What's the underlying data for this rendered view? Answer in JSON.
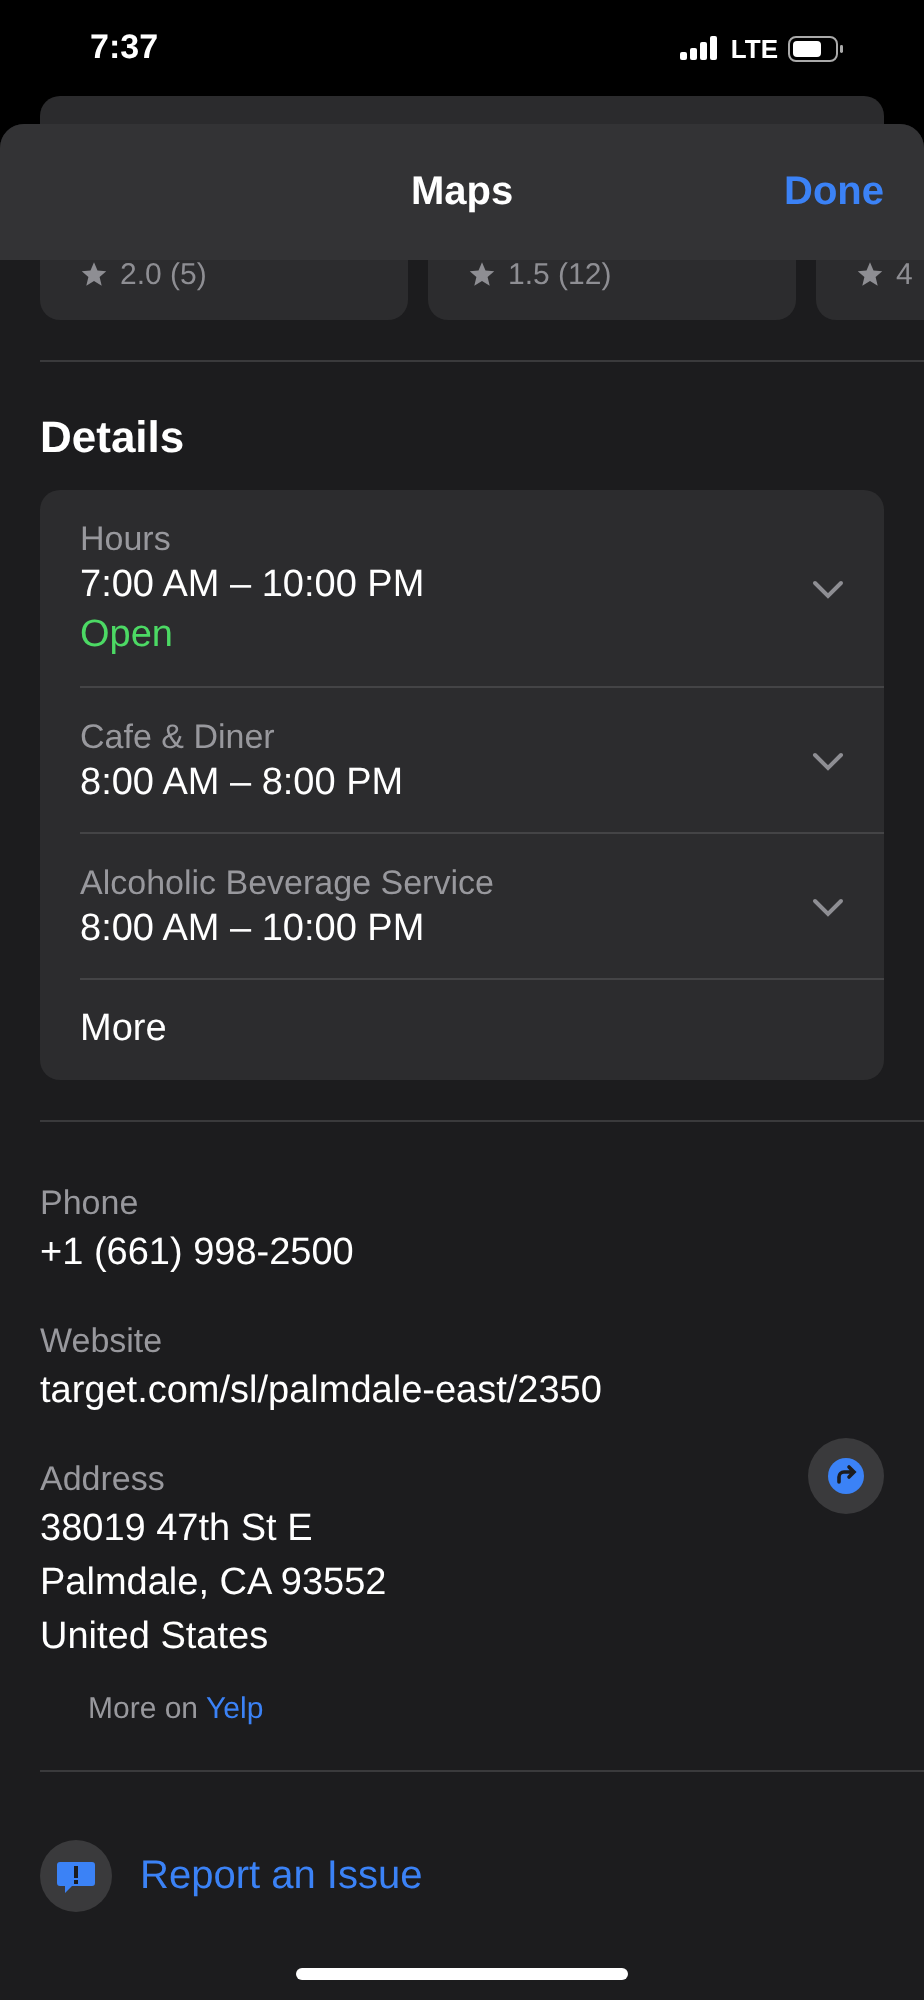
{
  "status_bar": {
    "time": "7:37",
    "network": "LTE"
  },
  "header": {
    "title": "Maps",
    "done": "Done"
  },
  "ratings": [
    "2.0 (5)",
    "1.5 (12)",
    "4"
  ],
  "details": {
    "title": "Details",
    "hours": [
      {
        "label": "Hours",
        "value": "7:00 AM – 10:00 PM",
        "status": "Open"
      },
      {
        "label": "Cafe & Diner",
        "value": "8:00 AM – 8:00 PM"
      },
      {
        "label": "Alcoholic Beverage Service",
        "value": "8:00 AM – 10:00 PM"
      }
    ],
    "more": "More"
  },
  "contact": [
    {
      "kind": "phone",
      "label": "Phone",
      "lines": [
        "+1 (661) 998-2500"
      ]
    },
    {
      "kind": "website",
      "label": "Website",
      "lines": [
        "target.com/sl/palmdale-east/2350"
      ]
    },
    {
      "kind": "address",
      "label": "Address",
      "lines": [
        "38019 47th St E",
        "Palmdale, CA 93552",
        "United States"
      ]
    }
  ],
  "more_on": {
    "text": "More on",
    "link": "Yelp"
  },
  "report": "Report an Issue"
}
